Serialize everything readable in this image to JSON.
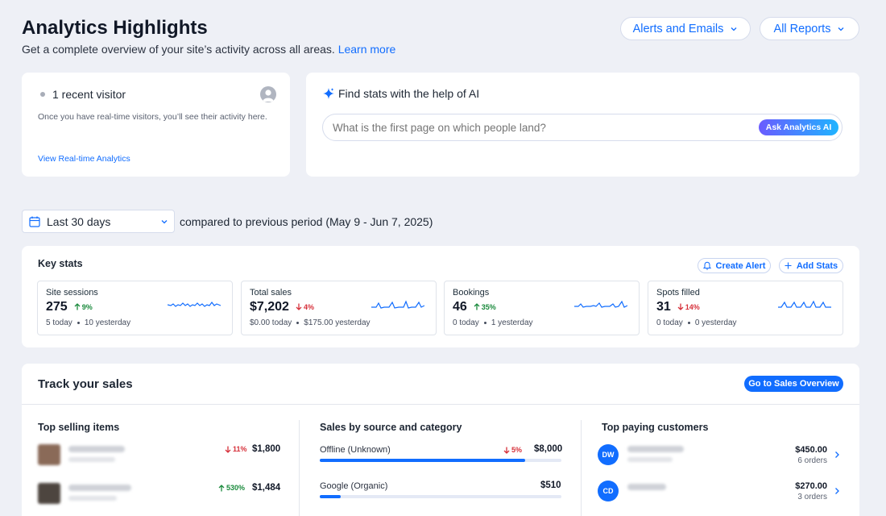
{
  "header": {
    "title": "Analytics Highlights",
    "subtitle": "Get a complete overview of your site’s activity across all areas.",
    "learn_more": "Learn more",
    "alerts_button": "Alerts and Emails",
    "reports_button": "All Reports"
  },
  "visitors": {
    "title": "1 recent visitor",
    "description": "Once you have real-time visitors, you’ll see their activity here.",
    "link": "View Real-time Analytics"
  },
  "ai": {
    "title": "Find stats with the help of AI",
    "placeholder": "What is the first page on which people land?",
    "button": "Ask Analytics AI"
  },
  "period": {
    "selected": "Last 30 days",
    "comparison": "compared to previous period (May 9 - Jun 7, 2025)"
  },
  "key_stats": {
    "title": "Key stats",
    "create_alert": "Create Alert",
    "add_stats": "Add Stats",
    "items": [
      {
        "title": "Site sessions",
        "value": "275",
        "direction": "up",
        "change": "9%",
        "today": "5 today",
        "yesterday": "10 yesterday"
      },
      {
        "title": "Total sales",
        "value": "$7,202",
        "direction": "down",
        "change": "4%",
        "today": "$0.00 today",
        "yesterday": "$175.00 yesterday"
      },
      {
        "title": "Bookings",
        "value": "46",
        "direction": "up",
        "change": "35%",
        "today": "0 today",
        "yesterday": "1 yesterday"
      },
      {
        "title": "Spots filled",
        "value": "31",
        "direction": "down",
        "change": "14%",
        "today": "0 today",
        "yesterday": "0 yesterday"
      }
    ]
  },
  "sales": {
    "title": "Track your sales",
    "overview_button": "Go to Sales Overview",
    "top_items": {
      "title": "Top selling items",
      "rows": [
        {
          "direction": "down",
          "change": "11%",
          "amount": "$1,800"
        },
        {
          "direction": "up",
          "change": "530%",
          "amount": "$1,484"
        }
      ]
    },
    "by_source": {
      "title": "Sales by source and category",
      "rows": [
        {
          "label": "Offline (Unknown)",
          "direction": "down",
          "change": "5%",
          "amount": "$8,000",
          "fill": 0.85
        },
        {
          "label": "Google (Organic)",
          "amount": "$510",
          "fill": 0.085
        }
      ]
    },
    "top_customers": {
      "title": "Top paying customers",
      "rows": [
        {
          "initials": "DW",
          "amount": "$450.00",
          "orders": "6 orders"
        },
        {
          "initials": "CD",
          "amount": "$270.00",
          "orders": "3 orders"
        }
      ]
    }
  },
  "colors": {
    "accent": "#116dff",
    "up": "#1a8a3c",
    "down": "#d6303a",
    "ai_gradient_start": "#6a5bff",
    "ai_gradient_end": "#1fb4ff"
  }
}
